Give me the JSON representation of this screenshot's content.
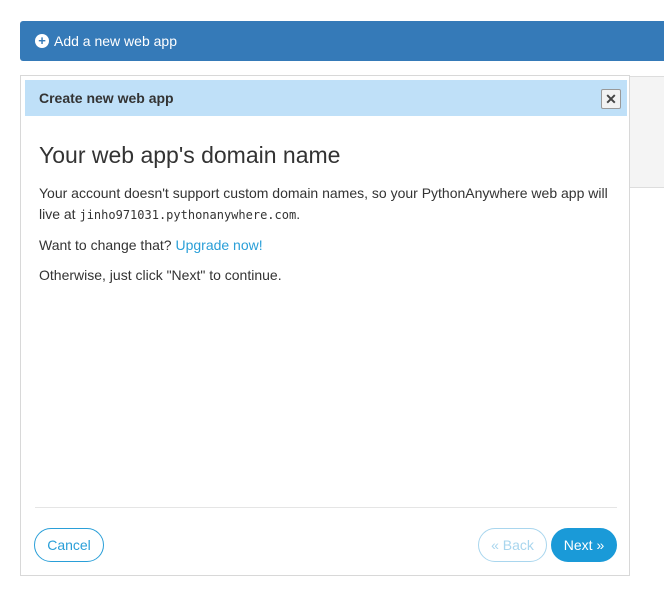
{
  "add_app": {
    "icon": "plus-circle-icon",
    "label": "Add a new web app"
  },
  "modal": {
    "title": "Create new web app",
    "close_icon": "close-icon",
    "heading": "Your web app's domain name",
    "para1_text": "Your account doesn't support custom domain names, so your PythonAnywhere web app will live at ",
    "domain": "jinho971031.pythonanywhere.com",
    "para1_end": ".",
    "para2_text": "Want to change that? ",
    "upgrade_link": "Upgrade now!",
    "para3_text": "Otherwise, just click \"Next\" to continue.",
    "buttons": {
      "cancel": "Cancel",
      "back": "« Back",
      "next": "Next »"
    }
  },
  "colors": {
    "primary_bar": "#357ab8",
    "modal_header": "#bfe0f8",
    "accent": "#2a9fd8",
    "next_button": "#1a9ad8"
  }
}
